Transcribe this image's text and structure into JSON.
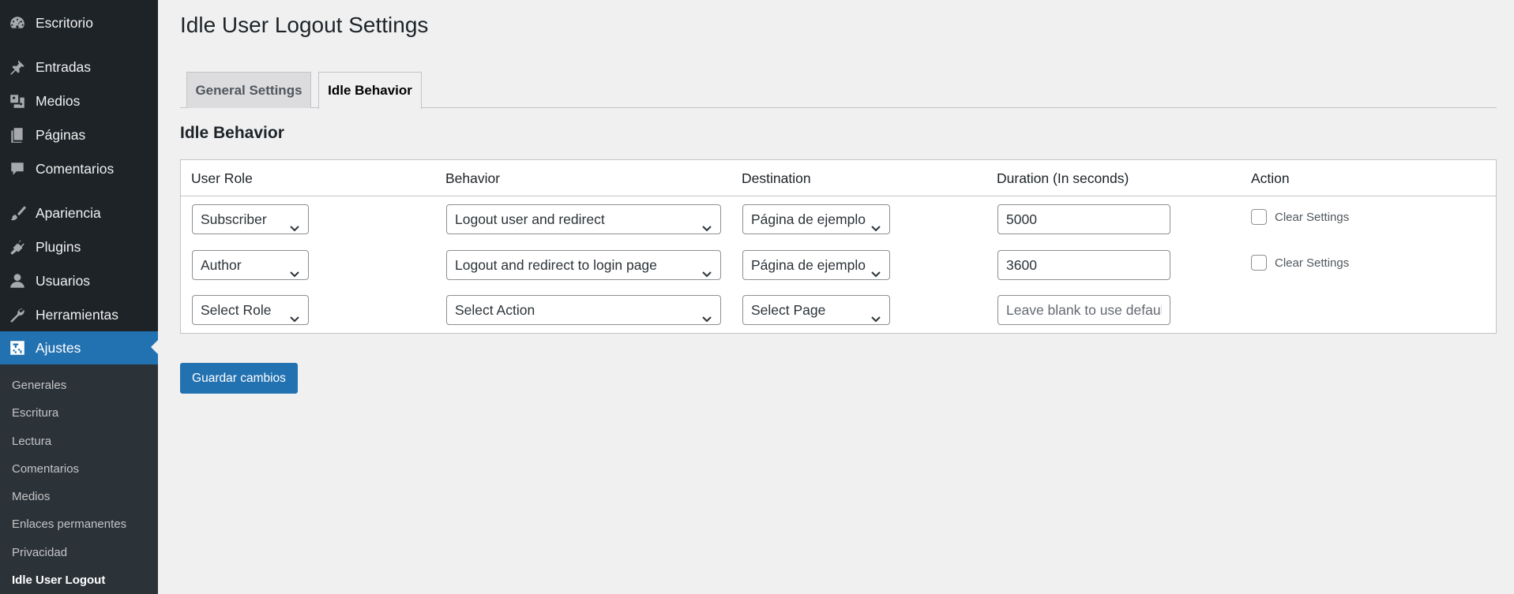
{
  "sidebar": {
    "items": [
      {
        "label": "Escritorio",
        "icon": "dashboard-icon"
      },
      {
        "label": "Entradas",
        "icon": "pushpin-icon"
      },
      {
        "label": "Medios",
        "icon": "media-icon"
      },
      {
        "label": "Páginas",
        "icon": "pages-icon"
      },
      {
        "label": "Comentarios",
        "icon": "comment-icon"
      },
      {
        "label": "Apariencia",
        "icon": "paintbrush-icon"
      },
      {
        "label": "Plugins",
        "icon": "plugin-icon"
      },
      {
        "label": "Usuarios",
        "icon": "user-icon"
      },
      {
        "label": "Herramientas",
        "icon": "wrench-icon"
      },
      {
        "label": "Ajustes",
        "icon": "settings-icon",
        "current": true
      }
    ],
    "submenu": [
      {
        "label": "Generales"
      },
      {
        "label": "Escritura"
      },
      {
        "label": "Lectura"
      },
      {
        "label": "Comentarios"
      },
      {
        "label": "Medios"
      },
      {
        "label": "Enlaces permanentes"
      },
      {
        "label": "Privacidad"
      },
      {
        "label": "Idle User Logout",
        "current": true
      }
    ]
  },
  "page": {
    "title": "Idle User Logout Settings",
    "tabs": [
      {
        "label": "General Settings",
        "active": false
      },
      {
        "label": "Idle Behavior",
        "active": true
      }
    ],
    "section_title": "Idle Behavior"
  },
  "table": {
    "headers": [
      "User Role",
      "Behavior",
      "Destination",
      "Duration (In seconds)",
      "Action"
    ],
    "rows": [
      {
        "role": "Subscriber",
        "behavior": "Logout user and redirect",
        "destination": "Página de ejemplo",
        "duration": "5000",
        "duration_placeholder": "",
        "action_label": "Clear Settings"
      },
      {
        "role": "Author",
        "behavior": "Logout and redirect to login page",
        "destination": "Página de ejemplo",
        "duration": "3600",
        "duration_placeholder": "",
        "action_label": "Clear Settings"
      },
      {
        "role": "Select Role",
        "behavior": "Select Action",
        "destination": "Select Page",
        "duration": "",
        "duration_placeholder": "Leave blank to use default"
      }
    ]
  },
  "save_button": "Guardar cambios",
  "colors": {
    "sidebar_bg": "#1d2327",
    "submenu_bg": "#2c3338",
    "accent": "#2271b1",
    "page_bg": "#f0f0f1"
  }
}
